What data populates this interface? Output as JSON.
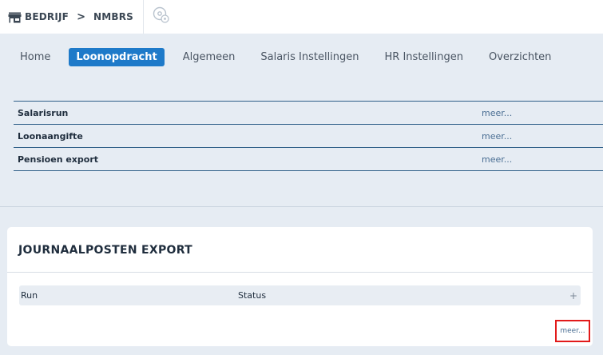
{
  "breadcrumb": {
    "company_label": "BEDRIJF",
    "separator": ">",
    "company_name": "NMBRS"
  },
  "nav": {
    "items": [
      {
        "label": "Home",
        "active": false
      },
      {
        "label": "Loonopdracht",
        "active": true
      },
      {
        "label": "Algemeen",
        "active": false
      },
      {
        "label": "Salaris Instellingen",
        "active": false
      },
      {
        "label": "HR Instellingen",
        "active": false
      },
      {
        "label": "Overzichten",
        "active": false
      }
    ]
  },
  "menu": {
    "rows": [
      {
        "label": "Salarisrun",
        "more": "meer..."
      },
      {
        "label": "Loonaangifte",
        "more": "meer..."
      },
      {
        "label": "Pensioen export",
        "more": "meer..."
      }
    ]
  },
  "card": {
    "title": "JOURNAALPOSTEN EXPORT",
    "columns": {
      "run": "Run",
      "status": "Status",
      "add": "+"
    },
    "more": "meer..."
  },
  "colors": {
    "accent": "#1e7ac9",
    "highlight_border": "#e21a1a",
    "row_border": "#2f5f88",
    "background": "#e6ecf3"
  },
  "icons": {
    "store": "store-icon",
    "settings": "gear-settings-icon",
    "add": "plus-icon"
  }
}
